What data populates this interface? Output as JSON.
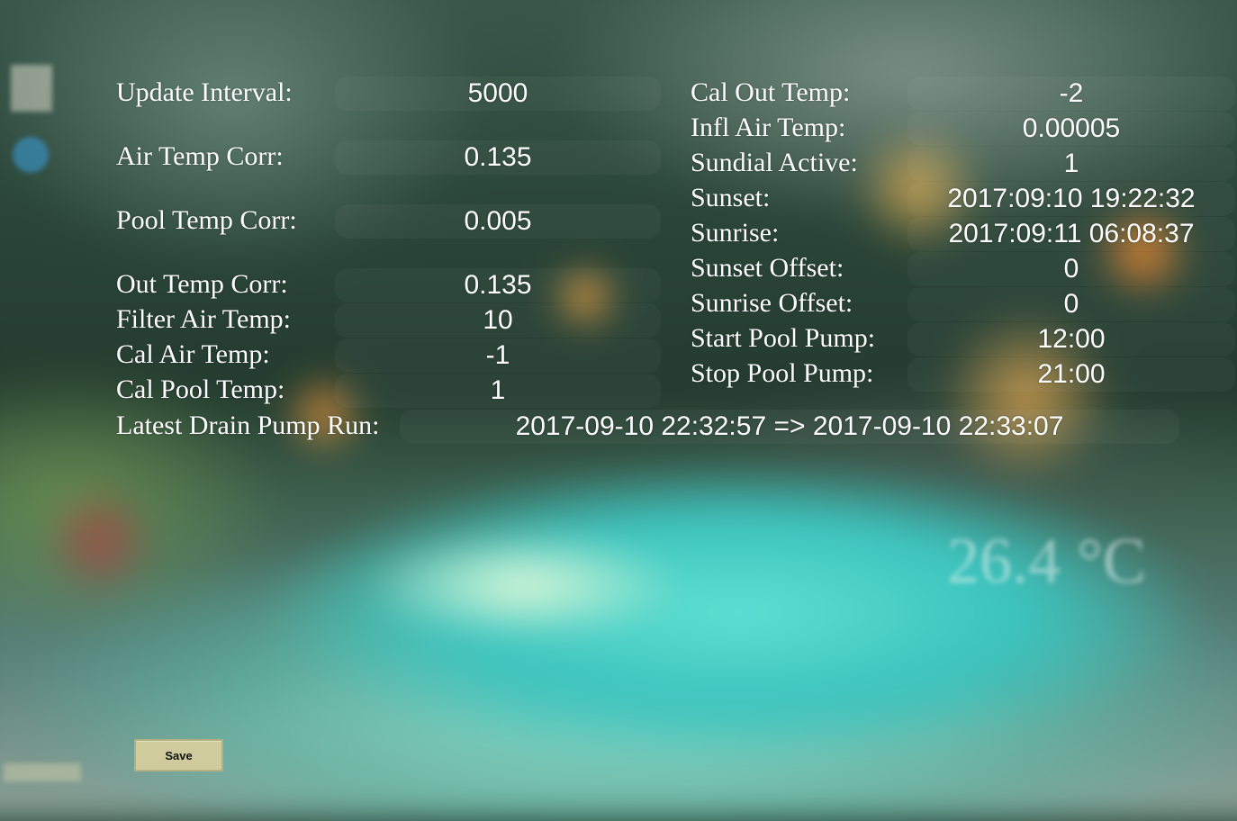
{
  "background": {
    "temperature_overlay": "26.4 °C",
    "colors": {
      "pool": "#3cc3bd",
      "foliage": "#243c2f",
      "save_button": "#cfcb9c"
    }
  },
  "settings_left": [
    {
      "label": "Update Interval:",
      "value": "5000"
    },
    {
      "label": "Air Temp Corr:",
      "value": "0.135"
    },
    {
      "label": "Pool Temp Corr:",
      "value": "0.005"
    },
    {
      "label": "Out Temp Corr:",
      "value": "0.135"
    },
    {
      "label": "Filter Air Temp:",
      "value": "10"
    },
    {
      "label": "Cal Air Temp:",
      "value": "-1"
    },
    {
      "label": "Cal Pool Temp:",
      "value": "1"
    }
  ],
  "settings_right": [
    {
      "label": "Cal Out Temp:",
      "value": "-2"
    },
    {
      "label": "Infl Air Temp:",
      "value": "0.00005"
    },
    {
      "label": "Sundial Active:",
      "value": "1"
    },
    {
      "label": "Sunset:",
      "value": "2017:09:10 19:22:32"
    },
    {
      "label": "Sunrise:",
      "value": "2017:09:11 06:08:37"
    },
    {
      "label": "Sunset Offset:",
      "value": "0"
    },
    {
      "label": "Sunrise Offset:",
      "value": "0"
    },
    {
      "label": "Start Pool Pump:",
      "value": "12:00"
    },
    {
      "label": "Stop Pool Pump:",
      "value": "21:00"
    }
  ],
  "drain": {
    "label": "Latest Drain Pump Run:",
    "value": "2017-09-10 22:32:57 => 2017-09-10 22:33:07"
  },
  "actions": {
    "save_label": "Save"
  }
}
